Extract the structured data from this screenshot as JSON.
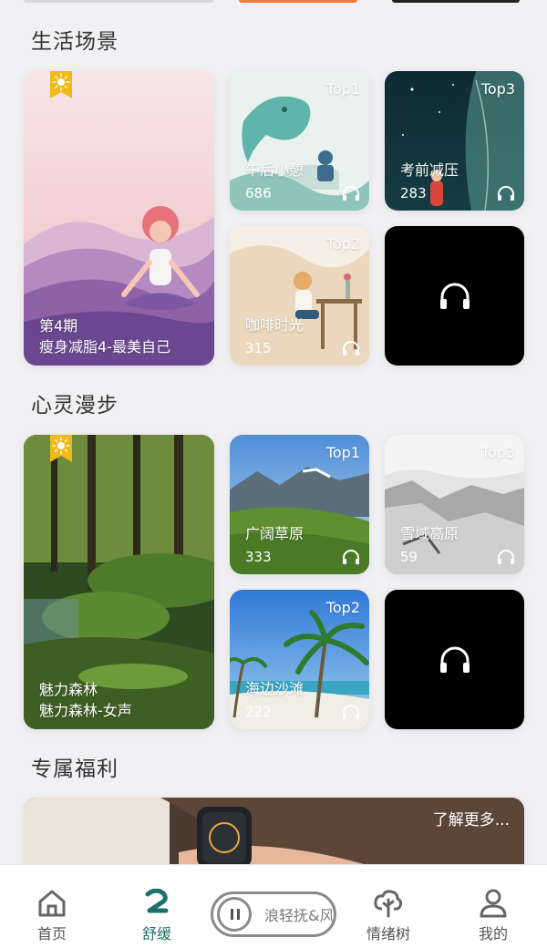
{
  "sections": {
    "life_scene": {
      "title": "生活场景",
      "featured": {
        "episode": "第4期",
        "name": "瘦身减脂4-最美自己"
      },
      "cards": [
        {
          "name": "午后小憩",
          "count": "686",
          "rank": "Top1"
        },
        {
          "name": "考前减压",
          "count": "283",
          "rank": "Top3"
        },
        {
          "name": "咖啡时光",
          "count": "315",
          "rank": "Top2"
        }
      ]
    },
    "soul_walk": {
      "title": "心灵漫步",
      "featured": {
        "episode": "魅力森林",
        "name": "魅力森林-女声"
      },
      "cards": [
        {
          "name": "广阔草原",
          "count": "333",
          "rank": "Top1"
        },
        {
          "name": "雪域高原",
          "count": "59",
          "rank": "Top3"
        },
        {
          "name": "海边沙滩",
          "count": "222",
          "rank": "Top2"
        }
      ]
    },
    "benefits": {
      "title": "专属福利",
      "banner_link": "了解更多..."
    }
  },
  "bottom_nav": {
    "home": "首页",
    "soothe": "舒缓",
    "mood_tree": "情绪树",
    "me": "我的"
  },
  "player": {
    "marquee": "浪轻抚&风"
  },
  "colors": {
    "accent": "#1f6f6a",
    "background": "#f1f1f4",
    "badge": "#f2b814"
  },
  "icons": [
    "sun-bookmark-icon",
    "headphones-icon",
    "home-icon",
    "soothe-icon",
    "pause-icon",
    "mood-tree-icon",
    "profile-icon"
  ]
}
